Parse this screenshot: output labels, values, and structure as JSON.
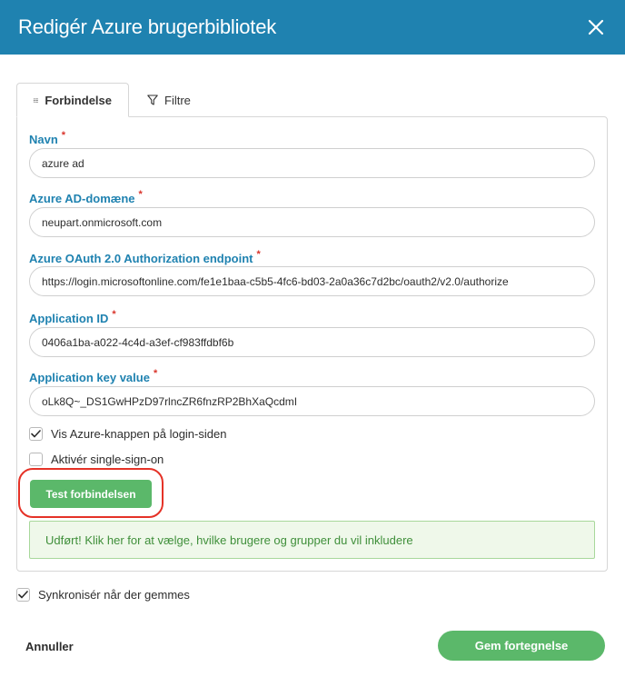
{
  "dialog": {
    "title": "Redigér Azure brugerbibliotek"
  },
  "tabs": [
    {
      "label": "Forbindelse",
      "icon": "list-icon",
      "active": true
    },
    {
      "label": "Filtre",
      "icon": "filter-icon",
      "active": false
    }
  ],
  "form": {
    "name": {
      "label": "Navn",
      "required_mark": "*",
      "value": "azure ad"
    },
    "domain": {
      "label": "Azure AD-domæne",
      "required_mark": "*",
      "value": "neupart.onmicrosoft.com"
    },
    "endpoint": {
      "label": "Azure OAuth 2.0 Authorization endpoint",
      "required_mark": "*",
      "value": "https://login.microsoftonline.com/fe1e1baa-c5b5-4fc6-bd03-2a0a36c7d2bc/oauth2/v2.0/authorize"
    },
    "app_id": {
      "label": "Application ID",
      "required_mark": "*",
      "value": "0406a1ba-a022-4c4d-a3ef-cf983ffdbf6b"
    },
    "app_key": {
      "label": "Application key value",
      "required_mark": "*",
      "value": "oLk8Q~_DS1GwHPzD97rlncZR6fnzRP2BhXaQcdmI"
    },
    "show_azure_button": {
      "label": "Vis Azure-knappen på login-siden",
      "checked": true
    },
    "sso": {
      "label": "Aktivér single-sign-on",
      "checked": false
    },
    "test_button": "Test forbindelsen",
    "success_message": "Udført! Klik her for at vælge, hvilke brugere og grupper du vil inkludere"
  },
  "sync_on_save": {
    "label": "Synkronisér når der gemmes",
    "checked": true
  },
  "footer": {
    "cancel": "Annuller",
    "save": "Gem fortegnelse"
  },
  "colors": {
    "header": "#1f82b0",
    "label": "#1f82b0",
    "required": "#d9342b",
    "primary_button": "#5bb86a",
    "success_bg": "#eff8ea",
    "success_text": "#3f8f3a",
    "highlight": "#e53227"
  }
}
